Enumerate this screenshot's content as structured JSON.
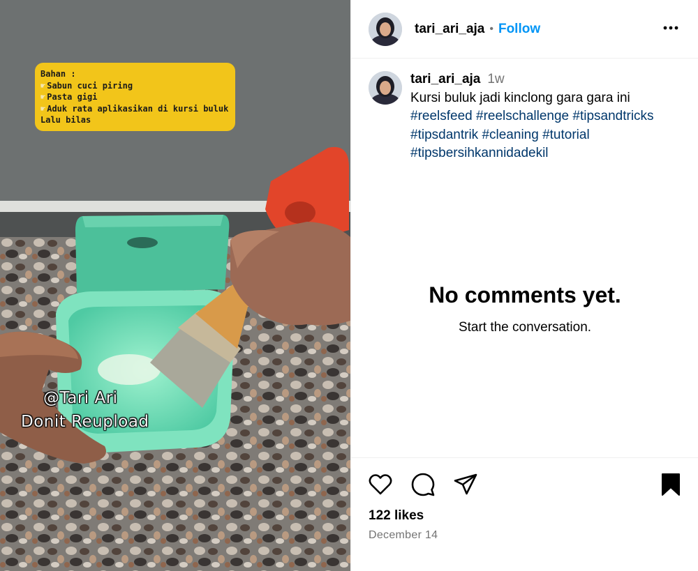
{
  "media": {
    "overlay_caption": [
      {
        "text": "Bahan :",
        "bullet": false
      },
      {
        "text": "Sabun cuci piring",
        "bullet": true
      },
      {
        "text": "Pasta gigi",
        "bullet": true
      },
      {
        "text": "Aduk rata aplikasikan di kursi buluk",
        "bullet": true
      },
      {
        "text": "Lalu bilas",
        "bullet": false
      }
    ],
    "watermark_line1": "@Tari Ari",
    "watermark_line2": "Donit Reupload"
  },
  "header": {
    "username": "tari_ari_aja",
    "separator": "•",
    "follow_label": "Follow",
    "more_icon": "more-horizontal-icon"
  },
  "caption": {
    "username": "tari_ari_aja",
    "time": "1w",
    "text": "Kursi buluk jadi kinclong gara gara ini",
    "hashtags": [
      "#reelsfeed",
      "#reelschallenge",
      "#tipsandtricks",
      "#tipsdantrik",
      "#cleaning",
      "#tutorial",
      "#tipsbersihkannidadekil"
    ]
  },
  "comments": {
    "empty_title": "No comments yet.",
    "empty_subtitle": "Start the conversation."
  },
  "actions": {
    "icons": [
      "heart-icon",
      "comment-icon",
      "share-icon",
      "bookmark-icon"
    ],
    "likes": "122 likes",
    "date": "December 14"
  },
  "colors": {
    "follow": "#0095f6",
    "hashtag": "#00376b",
    "muted": "#737373",
    "overlay_box": "#f2c51a"
  }
}
